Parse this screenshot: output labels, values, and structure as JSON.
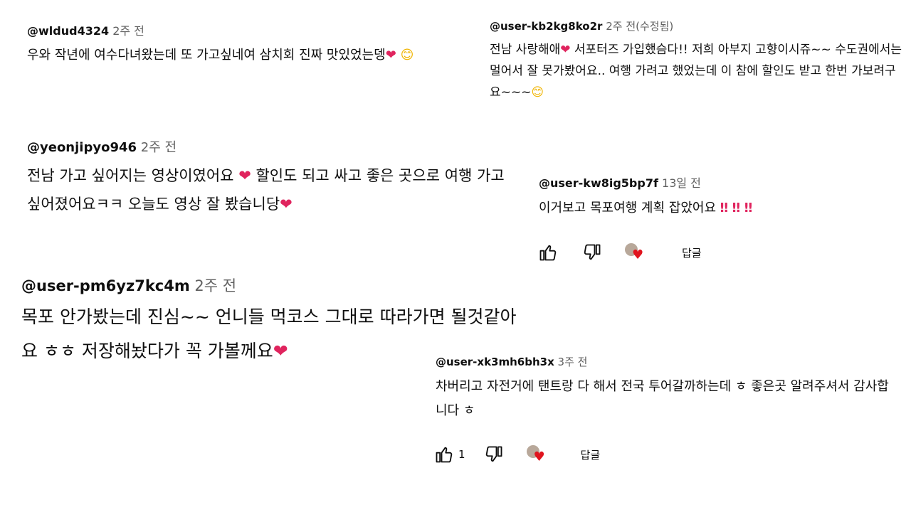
{
  "comments": [
    {
      "handle": "@wldud4324",
      "time": "2주 전",
      "text": "우와 작년에 여수다녀왔는데 또 가고싶네여 삼치회 진짜 맛있었는뎅",
      "emojis": [
        "❤",
        "😊"
      ]
    },
    {
      "handle": "@user-kb2kg8ko2r",
      "time": "2주 전(수정됨)",
      "text_a": "전남 사랑해애",
      "text_b": " 서포터즈 가입했슴다!! 저희 아부지 고향이시쥬~~ 수도권에서는 멀어서 잘 못가봤어요.. 여행 가려고 했었는데 이 참에 할인도 받고 한번 가보려구요~~~",
      "emojis": [
        "❤",
        "😊"
      ]
    },
    {
      "handle": "@yeonjipyo946",
      "time": "2주 전",
      "text_a": "전남 가고 싶어지는 영상이였어요 ",
      "text_b": " 할인도 되고 싸고 좋은 곳으로 여행 가고 싶어졌어요ㅋㅋ 오늘도 영상 잘 봤습니당",
      "emojis": [
        "❤",
        "❤"
      ]
    },
    {
      "handle": "@user-kw8ig5bp7f",
      "time": "13일 전",
      "text": "이거보고 목포여행 계획 잡았어요",
      "emojis": [
        "‼",
        "‼",
        "‼"
      ]
    },
    {
      "handle": "@user-pm6yz7kc4m",
      "time": "2주 전",
      "text_line1": "목포 안가봤는데 진심~~ 언니들 먹코스 그대로 따라가면 될것같아",
      "text_line2": "요 ㅎㅎ 저장해놨다가 꼭 가볼께요",
      "emojis": [
        "❤"
      ]
    },
    {
      "handle": "@user-xk3mh6bh3x",
      "time": "3주 전",
      "text": "차버리고 자전거에 탠트랑 다 해서 전국 투어갈까하는데 ㅎ 좋은곳 알려주셔서 감사합니다 ㅎ"
    }
  ],
  "actions": {
    "reply_label": "답글",
    "like_count_2": "1"
  },
  "colors": {
    "heart": "#e0245e",
    "muted": "#606060"
  }
}
